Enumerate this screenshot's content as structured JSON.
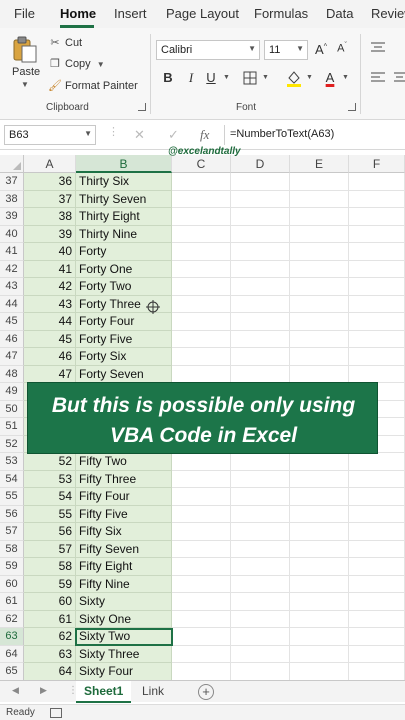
{
  "ribbon_tabs": [
    "File",
    "Home",
    "Insert",
    "Page Layout",
    "Formulas",
    "Data",
    "Review"
  ],
  "clipboard": {
    "paste": "Paste",
    "cut": "Cut",
    "copy": "Copy",
    "format_painter": "Format Painter",
    "group_label": "Clipboard"
  },
  "font": {
    "name": "Calibri",
    "size": "11",
    "group_label": "Font",
    "bold": "B",
    "italic": "I",
    "underline": "U",
    "grow": "A^",
    "shrink": "Aˇ",
    "font_color": "A"
  },
  "formula_bar": {
    "name_box": "B63",
    "fx": "fx",
    "formula": "=NumberToText(A63)"
  },
  "watermark": "@excelandtally",
  "columns": [
    "A",
    "B",
    "C",
    "D",
    "E",
    "F"
  ],
  "selected_cell": "B63",
  "rows": [
    {
      "row": "37",
      "a": "36",
      "b": "Thirty Six"
    },
    {
      "row": "38",
      "a": "37",
      "b": "Thirty Seven"
    },
    {
      "row": "39",
      "a": "38",
      "b": "Thirty Eight"
    },
    {
      "row": "40",
      "a": "39",
      "b": "Thirty Nine"
    },
    {
      "row": "41",
      "a": "40",
      "b": "Forty"
    },
    {
      "row": "42",
      "a": "41",
      "b": "Forty One"
    },
    {
      "row": "43",
      "a": "42",
      "b": "Forty Two"
    },
    {
      "row": "44",
      "a": "43",
      "b": "Forty Three"
    },
    {
      "row": "45",
      "a": "44",
      "b": "Forty Four"
    },
    {
      "row": "46",
      "a": "45",
      "b": "Forty Five"
    },
    {
      "row": "47",
      "a": "46",
      "b": "Forty Six"
    },
    {
      "row": "48",
      "a": "47",
      "b": "Forty Seven"
    },
    {
      "row": "49",
      "a": "",
      "b": ""
    },
    {
      "row": "50",
      "a": "",
      "b": ""
    },
    {
      "row": "51",
      "a": "",
      "b": ""
    },
    {
      "row": "52",
      "a": "",
      "b": ""
    },
    {
      "row": "53",
      "a": "52",
      "b": "Fifty Two"
    },
    {
      "row": "54",
      "a": "53",
      "b": "Fifty Three"
    },
    {
      "row": "55",
      "a": "54",
      "b": "Fifty Four"
    },
    {
      "row": "56",
      "a": "55",
      "b": "Fifty Five"
    },
    {
      "row": "57",
      "a": "56",
      "b": "Fifty Six"
    },
    {
      "row": "58",
      "a": "57",
      "b": "Fifty Seven"
    },
    {
      "row": "59",
      "a": "58",
      "b": "Fifty Eight"
    },
    {
      "row": "60",
      "a": "59",
      "b": "Fifty Nine"
    },
    {
      "row": "61",
      "a": "60",
      "b": "Sixty"
    },
    {
      "row": "62",
      "a": "61",
      "b": "Sixty One"
    },
    {
      "row": "63",
      "a": "62",
      "b": "Sixty Two"
    },
    {
      "row": "64",
      "a": "63",
      "b": "Sixty Three"
    },
    {
      "row": "65",
      "a": "64",
      "b": "Sixty Four"
    }
  ],
  "banner": {
    "line1": "But this is possible only using",
    "line2": "VBA Code in Excel"
  },
  "sheets": [
    "Sheet1",
    "Link"
  ],
  "active_sheet": "Sheet1",
  "status": "Ready",
  "colors": {
    "accent": "#1e7145",
    "selected_range_fill": "#e2efda",
    "banner_fill": "#1c7549"
  }
}
